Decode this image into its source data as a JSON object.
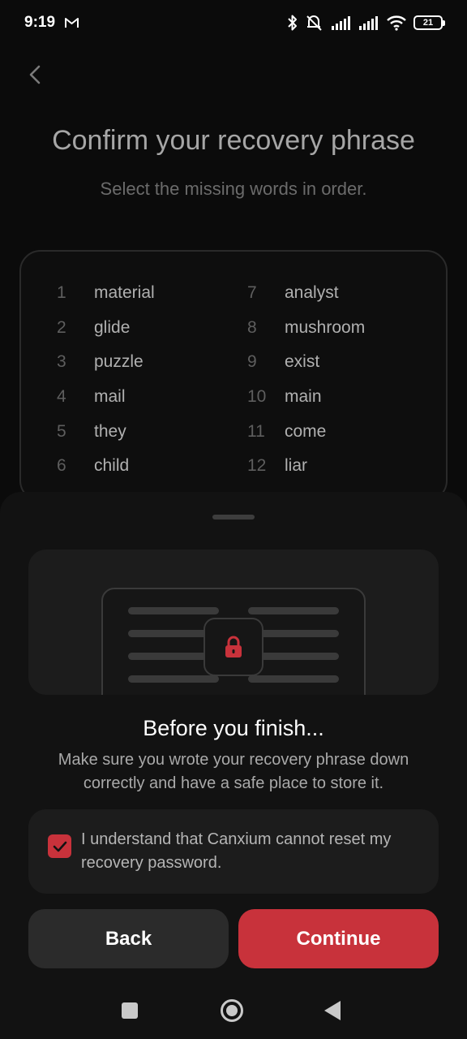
{
  "status_bar": {
    "time": "9:19",
    "battery": "21"
  },
  "header": {
    "title": "Confirm your recovery phrase",
    "subtitle": "Select the missing words in order."
  },
  "phrase": {
    "words": [
      {
        "num": "1",
        "word": "material"
      },
      {
        "num": "2",
        "word": "glide"
      },
      {
        "num": "3",
        "word": "puzzle"
      },
      {
        "num": "4",
        "word": "mail"
      },
      {
        "num": "5",
        "word": "they"
      },
      {
        "num": "6",
        "word": "child"
      },
      {
        "num": "7",
        "word": "analyst"
      },
      {
        "num": "8",
        "word": "mushroom"
      },
      {
        "num": "9",
        "word": "exist"
      },
      {
        "num": "10",
        "word": "main"
      },
      {
        "num": "11",
        "word": "come"
      },
      {
        "num": "12",
        "word": "liar"
      }
    ]
  },
  "sheet": {
    "title": "Before you finish...",
    "text": "Make sure you wrote your recovery phrase down correctly and have a safe place to store it.",
    "confirm_label": "I understand that Canxium cannot reset my recovery password.",
    "confirm_checked": true,
    "back_label": "Back",
    "continue_label": "Continue"
  },
  "colors": {
    "accent": "#c8323b",
    "background": "#0b0b0b",
    "sheet": "#121212"
  },
  "icons": [
    "gmail-icon",
    "bluetooth-icon",
    "mute-icon",
    "signal-icon",
    "wifi-icon",
    "battery-icon",
    "back-arrow-icon",
    "lock-icon",
    "check-icon"
  ]
}
